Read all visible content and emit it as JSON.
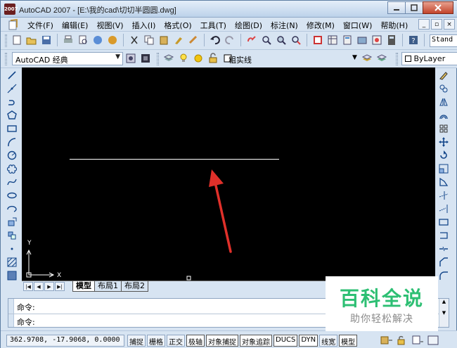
{
  "window": {
    "title": "AutoCAD 2007 - [E:\\我的cad\\切切半圆圆.dwg]",
    "app_icon_text": "2007"
  },
  "menu": {
    "items": [
      "文件(F)",
      "编辑(E)",
      "视图(V)",
      "插入(I)",
      "格式(O)",
      "工具(T)",
      "绘图(D)",
      "标注(N)",
      "修改(M)",
      "窗口(W)",
      "帮助(H)"
    ]
  },
  "toolbar2": {
    "workspace": "AutoCAD 经典",
    "layer": "粗实线",
    "bylayer": "ByLayer"
  },
  "toolbar1": {
    "text_style": "Stand"
  },
  "canvas": {
    "background": "#000000",
    "line_color": "#ffffff",
    "arrow_color": "#e0302a",
    "ucs_x_label": "X",
    "ucs_y_label": "Y"
  },
  "layout_tabs": [
    "模型",
    "布局1",
    "布局2"
  ],
  "command": {
    "line1": "命令:",
    "line2": "命令:"
  },
  "status": {
    "coordinates": "362.9708, -17.9068, 0.0000",
    "buttons": [
      "捕捉",
      "栅格",
      "正交",
      "极轴",
      "对象捕捉",
      "对象追踪",
      "DUCS",
      "DYN",
      "线宽",
      "模型"
    ]
  },
  "watermark": {
    "title": "百科全说",
    "subtitle": "助你轻松解决"
  }
}
